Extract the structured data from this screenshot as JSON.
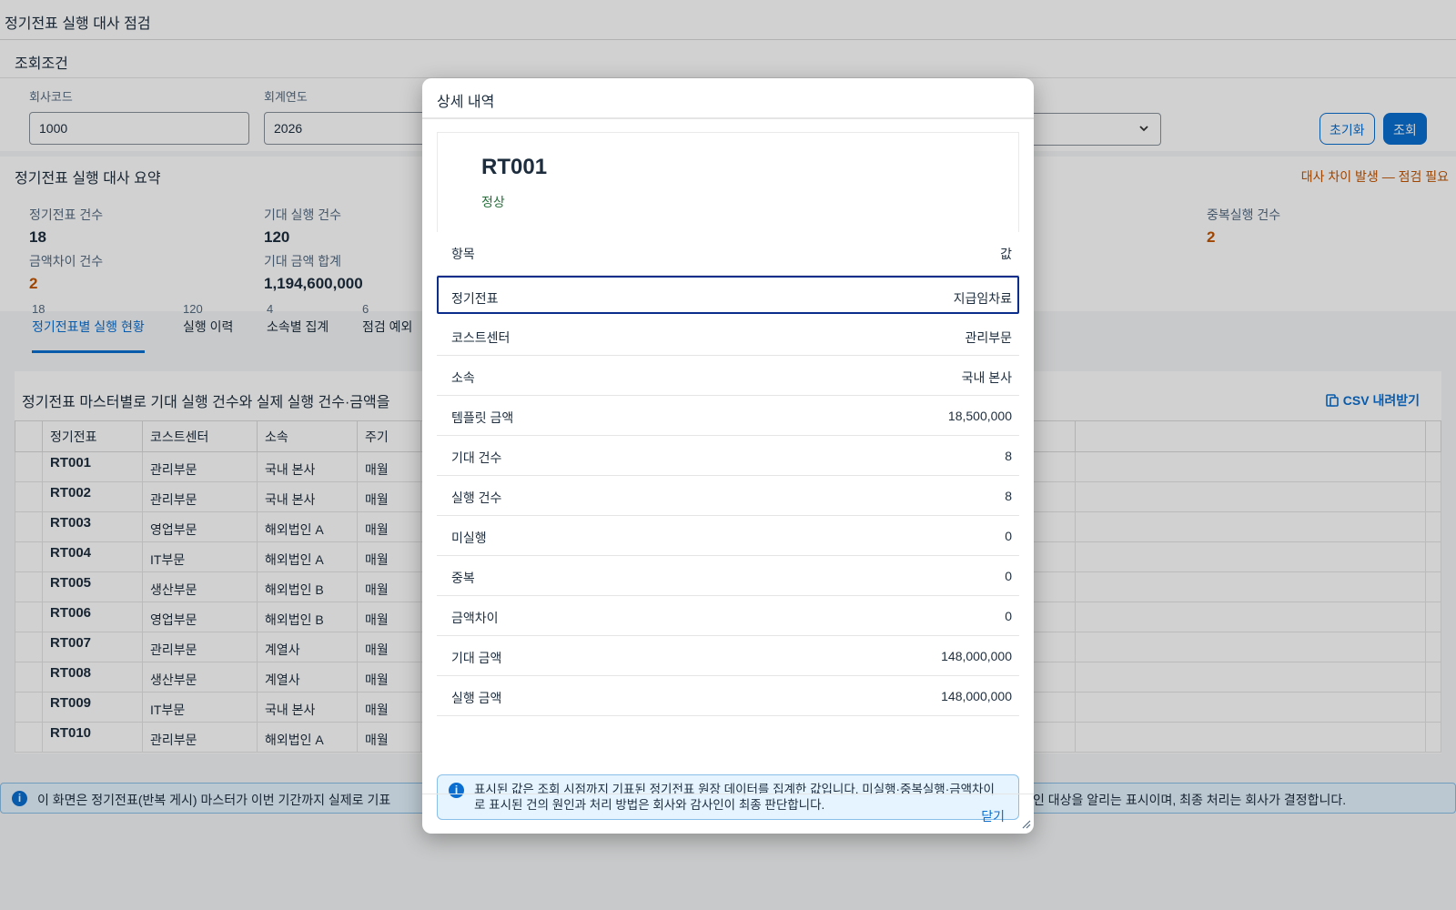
{
  "page": {
    "title": "정기전표 실행 대사 점검"
  },
  "filters": {
    "title": "조회조건",
    "company_label": "회사코드",
    "company_value": "1000",
    "year_label": "회계연도",
    "year_value": "2026",
    "reset_label": "초기화",
    "search_label": "조회"
  },
  "summary": {
    "title": "정기전표 실행 대사 요약",
    "alert": "대사 차이 발생 — 점검 필요",
    "kpis": [
      {
        "label": "정기전표 건수",
        "value": "18"
      },
      {
        "label": "기대 실행 건수",
        "value": "120"
      },
      {
        "label": "중복실행 건수",
        "value": "2"
      },
      {
        "label": "금액차이 건수",
        "value": "2"
      },
      {
        "label": "기대 금액 합계",
        "value": "1,194,600,000"
      }
    ]
  },
  "tabs": [
    {
      "count": "18",
      "label": "정기전표별 실행 현황"
    },
    {
      "count": "120",
      "label": "실행 이력"
    },
    {
      "count": "4",
      "label": "소속별 집계"
    },
    {
      "count": "6",
      "label": "점검 예외"
    }
  ],
  "table": {
    "caption": "정기전표 마스터별로 기대 실행 건수와 실제 실행 건수·금액을",
    "csv_label": "CSV 내려받기",
    "columns": [
      "정기전표",
      "코스트센터",
      "소속",
      "주기"
    ],
    "rows": [
      [
        "RT001",
        "관리부문",
        "국내 본사",
        "매월"
      ],
      [
        "RT002",
        "관리부문",
        "국내 본사",
        "매월"
      ],
      [
        "RT003",
        "영업부문",
        "해외법인 A",
        "매월"
      ],
      [
        "RT004",
        "IT부문",
        "해외법인 A",
        "매월"
      ],
      [
        "RT005",
        "생산부문",
        "해외법인 B",
        "매월"
      ],
      [
        "RT006",
        "영업부문",
        "해외법인 B",
        "매월"
      ],
      [
        "RT007",
        "관리부문",
        "계열사",
        "매월"
      ],
      [
        "RT008",
        "생산부문",
        "계열사",
        "매월"
      ],
      [
        "RT009",
        "IT부문",
        "국내 본사",
        "매월"
      ],
      [
        "RT010",
        "관리부문",
        "해외법인 A",
        "매월"
      ]
    ]
  },
  "info_bar": {
    "left": "이 화면은 정기전표(반복 게시) 마스터가 이번 기간까지 실제로 기표",
    "right": "인 대상을 알리는 표시이며, 최종 처리는 회사가 결정합니다."
  },
  "dialog": {
    "title": "상세 내역",
    "id": "RT001",
    "status": "정상",
    "header_key": "항목",
    "header_value": "값",
    "rows": [
      {
        "k": "정기전표",
        "v": "지급임차료"
      },
      {
        "k": "코스트센터",
        "v": "관리부문"
      },
      {
        "k": "소속",
        "v": "국내 본사"
      },
      {
        "k": "템플릿 금액",
        "v": "18,500,000"
      },
      {
        "k": "기대 건수",
        "v": "8"
      },
      {
        "k": "실행 건수",
        "v": "8"
      },
      {
        "k": "미실행",
        "v": "0"
      },
      {
        "k": "중복",
        "v": "0"
      },
      {
        "k": "금액차이",
        "v": "0"
      },
      {
        "k": "기대 금액",
        "v": "148,000,000"
      },
      {
        "k": "실행 금액",
        "v": "148,000,000"
      }
    ],
    "note": "표시된 값은 조회 시점까지 기표된 정기전표 원장 데이터를 집계한 값입니다. 미실행·중복실행·금액차이로 표시된 건의 원인과 처리 방법은 회사와 감사인이 최종 판단합니다.",
    "close_label": "닫기"
  },
  "colors": {
    "accent": "#0a6ed1",
    "warning": "#c35500",
    "success": "#256f3a"
  }
}
